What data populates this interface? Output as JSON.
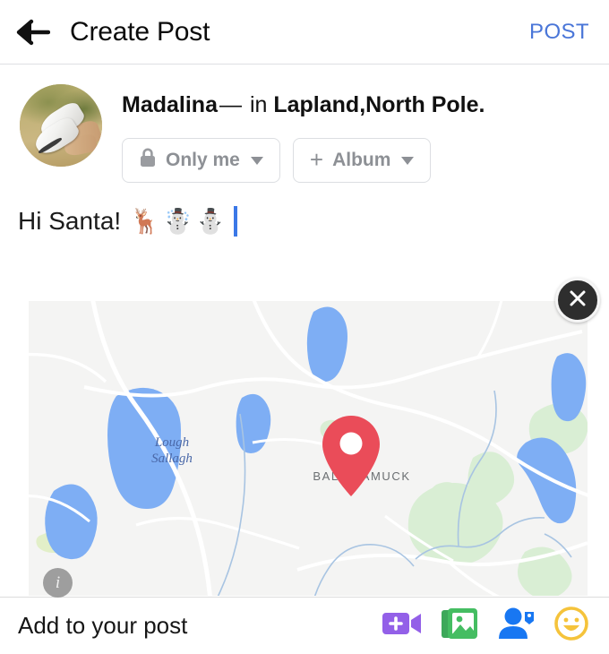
{
  "header": {
    "back_icon": "arrow-left-icon",
    "title": "Create Post",
    "post_label": "POST",
    "post_color": "#4a76d8"
  },
  "author": {
    "avatar_alt": "profile-photo-sneakers",
    "name": "Madalina",
    "dash": "—",
    "in_word": "in",
    "place": "Lapland,North Pole",
    "period": ".",
    "chips": [
      {
        "icon": "lock-icon",
        "label": "Only me",
        "caret": "chevron-down-icon"
      },
      {
        "icon": "plus-icon",
        "label": "Album",
        "caret": "chevron-down-icon"
      }
    ]
  },
  "composer": {
    "text": "Hi Santa!",
    "emoji": "🦌☃️⛄",
    "cursor_color": "#3b78e7"
  },
  "map": {
    "close_icon": "close-icon",
    "info_icon": "info-icon",
    "pin_icon": "map-pin-icon",
    "pin_color": "#ea4c59",
    "water_color": "#7eaef4",
    "land_color": "#f4f4f3",
    "park_color": "#d7ead2",
    "road_color": "#ffffff",
    "labels": [
      {
        "name": "lake-label",
        "text": "Lough\nSallagh",
        "line1": "Lough",
        "line2": "Sallagh",
        "color": "#4a68a8"
      },
      {
        "name": "town-label",
        "text": "BALLINAMUCK",
        "color": "#6b6f72"
      }
    ]
  },
  "bottom": {
    "label": "Add to your post",
    "icons": [
      {
        "name": "live-video-icon",
        "color": "#9360e8"
      },
      {
        "name": "photo-icon",
        "color": "#45bd62"
      },
      {
        "name": "tag-person-icon",
        "color": "#1877f2"
      },
      {
        "name": "emoji-icon",
        "color": "#f5c33b"
      }
    ]
  }
}
